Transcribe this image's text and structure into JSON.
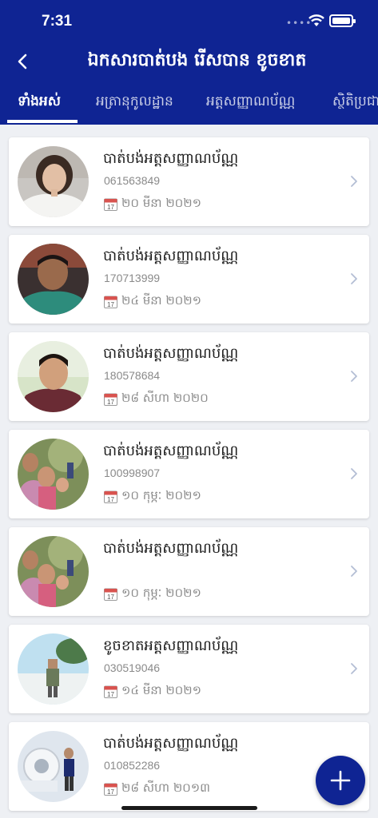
{
  "status": {
    "time": "7:31"
  },
  "header": {
    "title": "ឯកសារបាត់បង រើសបាន ខូចខាត"
  },
  "tabs": [
    {
      "label": "ទាំងអស់",
      "active": true
    },
    {
      "label": "អត្រានុកូលដ្ឋាន",
      "active": false
    },
    {
      "label": "អត្តសញ្ញាណប័ណ្ណ",
      "active": false
    },
    {
      "label": "ស្ថិតិប្រជា",
      "active": false
    }
  ],
  "items": [
    {
      "category": "បាត់បង់អត្តសញ្ញាណប័ណ្ណ",
      "phone": "061563849",
      "date": "២០ មីនា ២០២១"
    },
    {
      "category": "បាត់បង់អត្តសញ្ញាណប័ណ្ណ",
      "phone": "170713999",
      "date": "២៤ មីនា ២០២១"
    },
    {
      "category": "បាត់បង់អត្តសញ្ញាណប័ណ្ណ",
      "phone": "180578684",
      "date": "២៨ សីហា ២០២០"
    },
    {
      "category": "បាត់បង់អត្តសញ្ញាណប័ណ្ណ",
      "phone": "100998907",
      "date": "១០ កុម្ភៈ ២០២១"
    },
    {
      "category": "បាត់បង់អត្តសញ្ញាណប័ណ្ណ",
      "phone": "",
      "date": "១០ កុម្ភៈ ២០២១"
    },
    {
      "category": "ខូចខាតអត្តសញ្ញាណប័ណ្ណ",
      "phone": "030519046",
      "date": "១៤ មីនា ២០២១"
    },
    {
      "category": "បាត់បង់អត្តសញ្ញាណប័ណ្ណ",
      "phone": "010852286",
      "date": "២៨ សីហា ២០១៣"
    }
  ],
  "colors": {
    "brand": "#0f2493",
    "background": "#eef0f4"
  },
  "icons": {
    "back": "chevron-left-icon",
    "row_arrow": "chevron-right-icon",
    "date": "calendar-icon",
    "add": "plus-icon"
  }
}
